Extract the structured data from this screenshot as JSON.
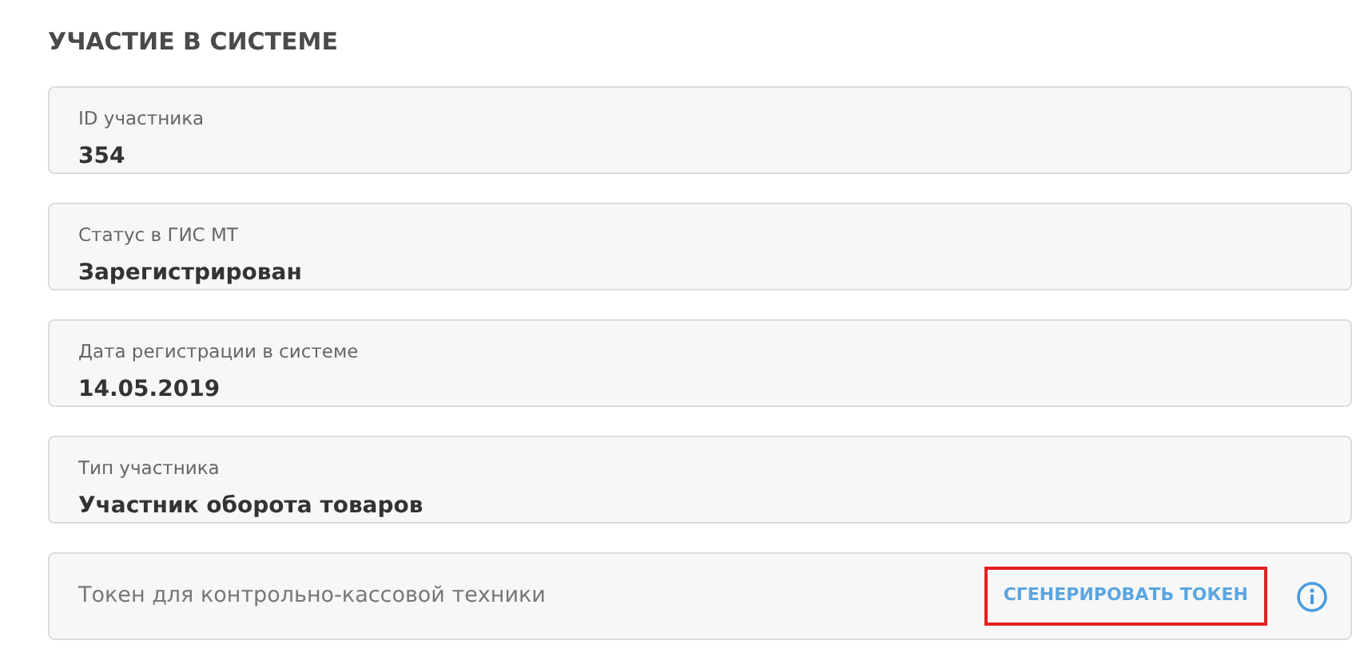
{
  "title": "УЧАСТИЕ В СИСТЕМЕ",
  "fields": [
    {
      "kind": "readonly",
      "label": "ID участника",
      "value": "354"
    },
    {
      "kind": "readonly",
      "label": "Статус в ГИС МТ",
      "value": "Зарегистрирован"
    },
    {
      "kind": "readonly",
      "label": "Дата регистрации в системе",
      "value": "14.05.2019"
    },
    {
      "kind": "readonly",
      "label": "Тип участника",
      "value": "Участник оборота товаров"
    },
    {
      "kind": "action",
      "label": "Токен для контрольно-кассовой техники",
      "button": {
        "label": "СГЕНЕРИРОВАТЬ ТОКЕН",
        "highlighted": true
      }
    }
  ]
}
